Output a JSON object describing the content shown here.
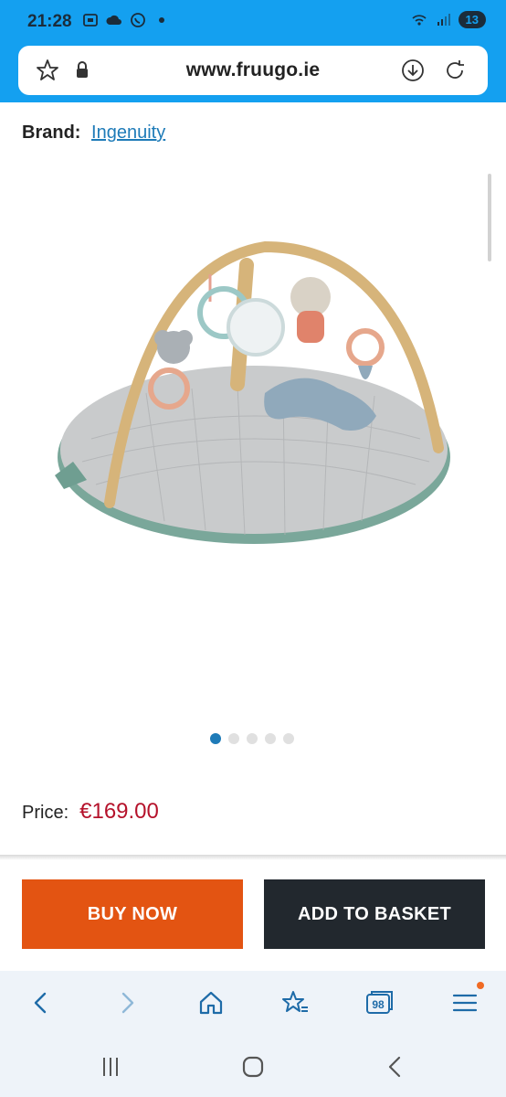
{
  "status_bar": {
    "time": "21:28",
    "battery": "13",
    "icons_left": [
      "screenshot-icon",
      "cloud-icon",
      "whatsapp-icon",
      "dot-icon"
    ],
    "icons_right": [
      "wifi-icon",
      "signal-icon",
      "battery-icon"
    ]
  },
  "browser": {
    "url": "www.fruugo.ie",
    "icons": [
      "star-icon",
      "lock-icon",
      "download-icon",
      "reload-icon"
    ],
    "tab_count": "98"
  },
  "product": {
    "brand_label": "Brand:",
    "brand_name": "Ingenuity",
    "image_alt": "baby activity gym with wooden arch and hanging toys",
    "carousel_total": 5,
    "carousel_active": 1,
    "price_label": "Price:",
    "price": "€169.00"
  },
  "actions": {
    "buy_now": "BUY NOW",
    "add_to_basket": "ADD TO BASKET"
  },
  "colors": {
    "status_bar": "#14a0f0",
    "buy_now": "#e35412",
    "add_to_basket": "#22282e",
    "price": "#b5122b",
    "link": "#1e7bb8"
  }
}
